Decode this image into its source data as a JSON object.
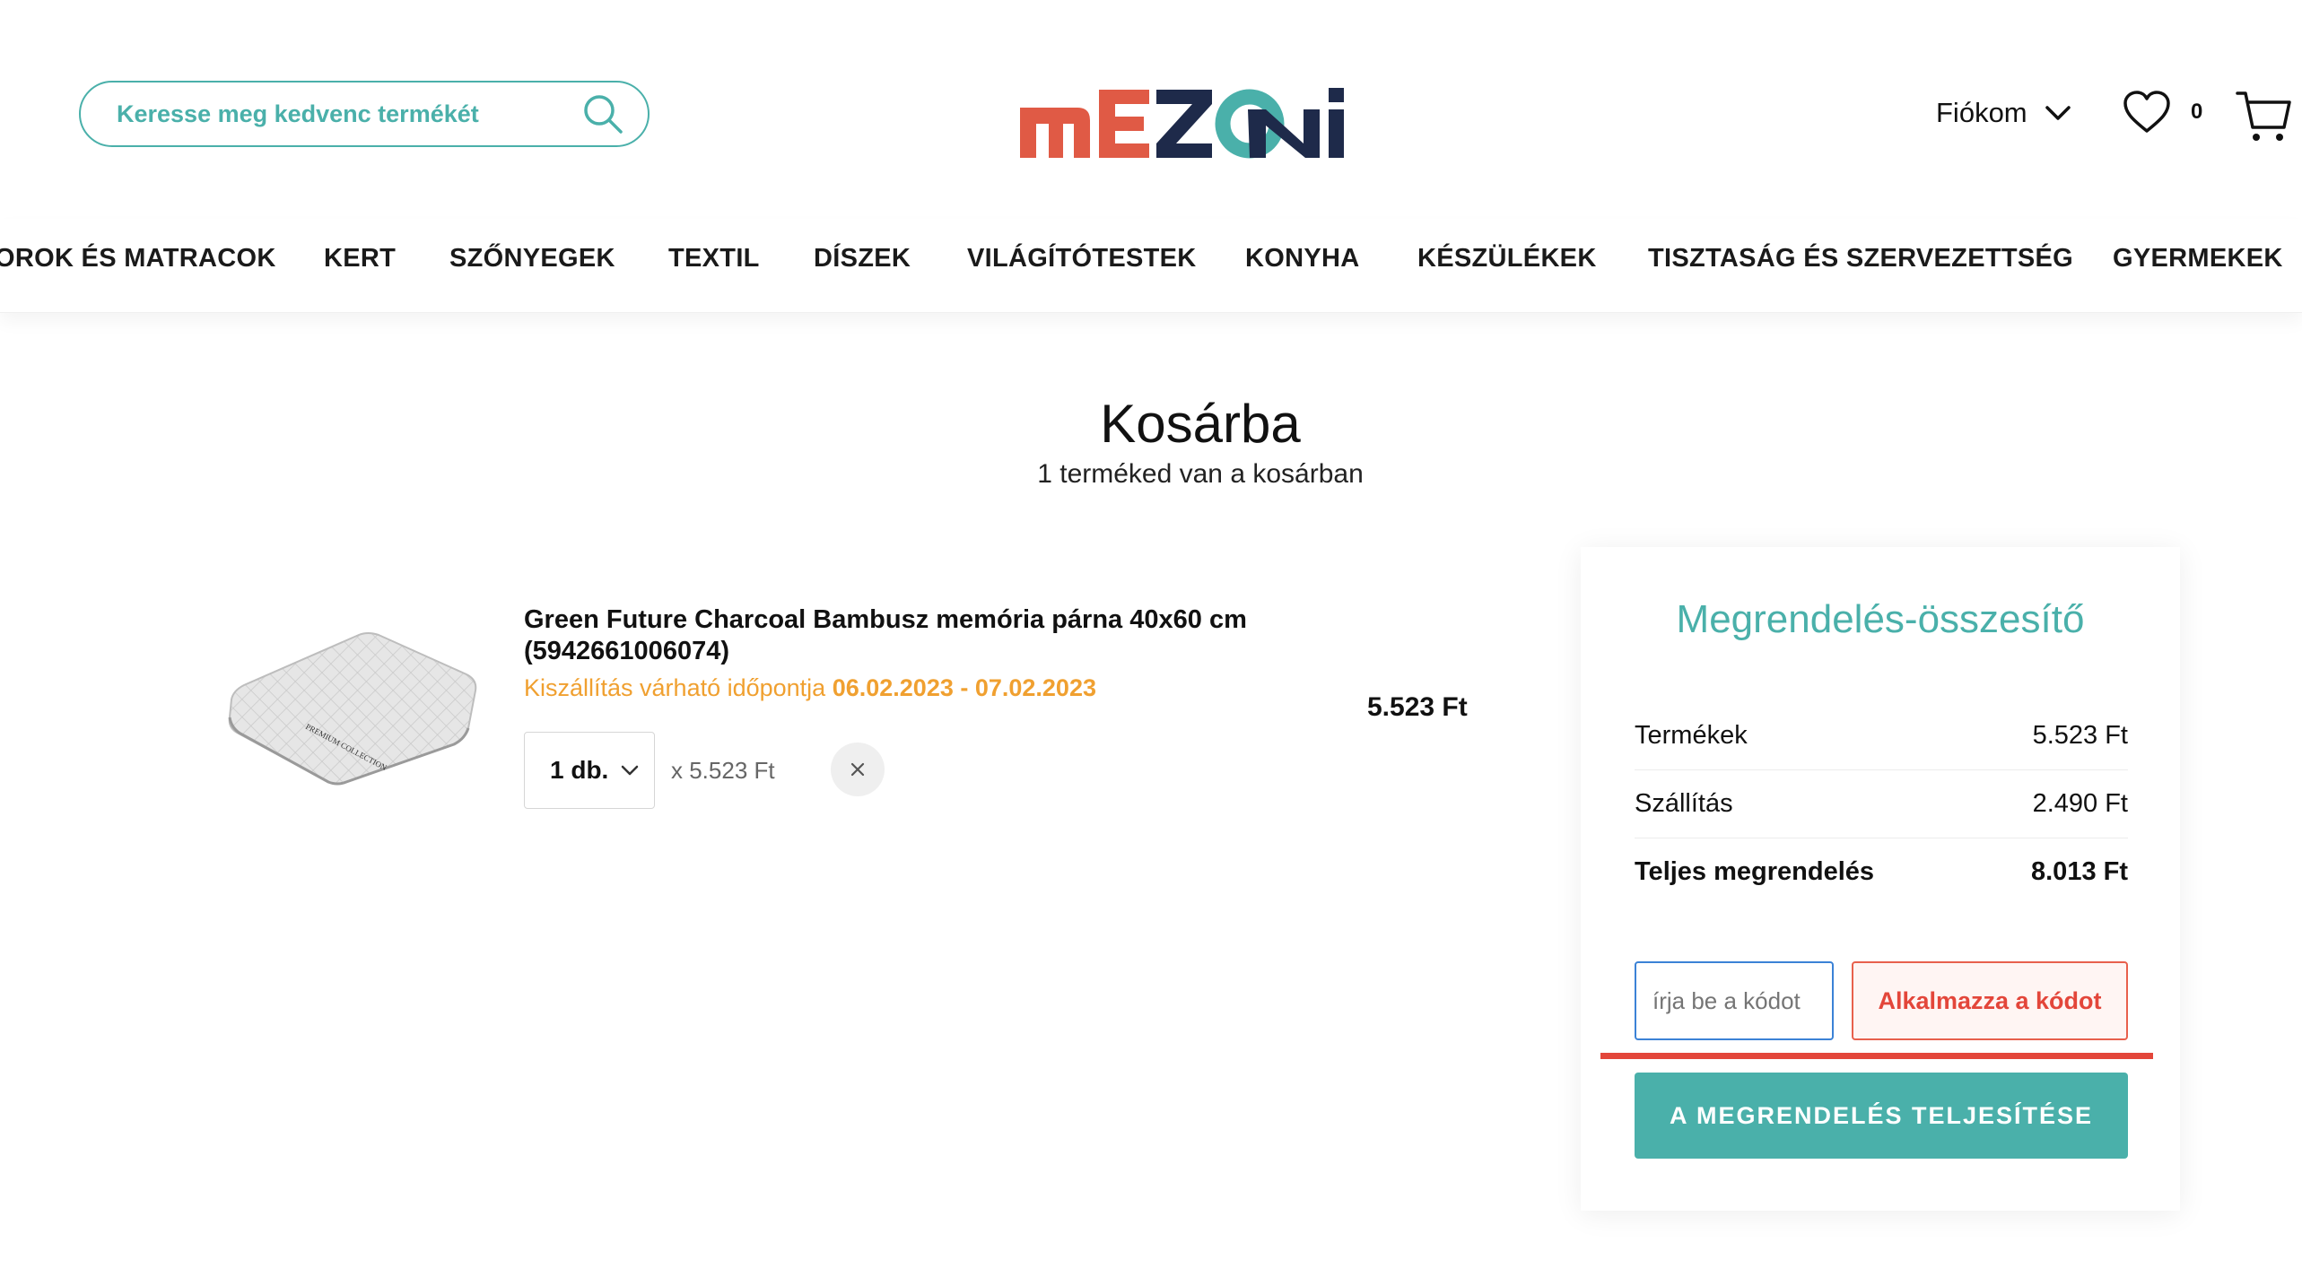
{
  "header": {
    "search_placeholder": "Keresse meg kedvenc termékét",
    "account_label": "Fiókom",
    "wishlist_count": "0"
  },
  "logo": {
    "text": "mEZONi"
  },
  "nav": {
    "items": [
      "OROK ÉS MATRACOK",
      "KERT",
      "SZŐNYEGEK",
      "TEXTIL",
      "DÍSZEK",
      "VILÁGÍTÓTESTEK",
      "KONYHA",
      "KÉSZÜLÉKEK",
      "TISZTASÁG ÉS SZERVEZETTSÉG",
      "GYERMEKEK"
    ]
  },
  "page": {
    "title": "Kosárba",
    "subtitle": "1 terméked van a kosárban"
  },
  "cart_item": {
    "name": "Green Future Charcoal Bambusz memória párna 40x60 cm (5942661006074)",
    "delivery_label": "Kiszállítás várható időpontja",
    "delivery_dates": "06.02.2023 - 07.02.2023",
    "quantity": "1 db.",
    "unit_price": "x 5.523 Ft",
    "line_total": "5.523 Ft",
    "image_caption": "PREMIUM COLLECTION"
  },
  "summary": {
    "title": "Megrendelés-összesítő",
    "rows": [
      {
        "label": "Termékek",
        "value": "5.523 Ft"
      },
      {
        "label": "Szállítás",
        "value": "2.490 Ft"
      },
      {
        "label": "Teljes megrendelés",
        "value": "8.013 Ft"
      }
    ],
    "coupon_placeholder": "írja be a kódot",
    "coupon_button": "Alkalmazza a kódot",
    "checkout_button": "A MEGRENDELÉS TELJESÍTÉSE"
  },
  "colors": {
    "teal": "#4ab0aa",
    "red": "#e3463a",
    "navy": "#1e2a4a",
    "orange": "#f0a030"
  }
}
